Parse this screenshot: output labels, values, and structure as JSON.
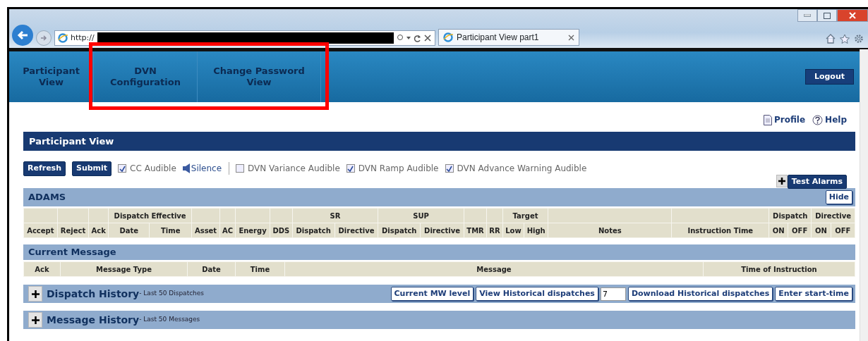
{
  "browser": {
    "address": "http://",
    "tab_title": "Participant View part1"
  },
  "nav": {
    "items": [
      {
        "label": "Participant View"
      },
      {
        "label": "DVN Configuration"
      },
      {
        "label": "Change Password View"
      }
    ],
    "logout": "Logout"
  },
  "top_links": [
    {
      "kind": "profile",
      "label": "Profile"
    },
    {
      "kind": "help",
      "label": "Help"
    }
  ],
  "panel_title": "Participant View",
  "toolbar": {
    "buttons": [
      "Refresh",
      "Submit"
    ],
    "items": [
      {
        "kind": "checkbox",
        "label": "CC Audible",
        "checked": true
      },
      {
        "kind": "speaker",
        "label": "Silence"
      },
      {
        "kind": "checkbox",
        "label": "DVN Variance Audible",
        "checked": false
      },
      {
        "kind": "checkbox",
        "label": "DVN Ramp Audible",
        "checked": true
      },
      {
        "kind": "checkbox",
        "label": "DVN Advance Warning Audible",
        "checked": true
      }
    ]
  },
  "test_alarms": "Test Alarms",
  "adams": {
    "title": "ADAMS",
    "hide": "Hide",
    "columns": [
      {
        "label": "Accept"
      },
      {
        "label": "Reject"
      },
      {
        "label": "Ack"
      },
      {
        "label": "Dispatch Effective",
        "sub": [
          "Date",
          "Time"
        ]
      },
      {
        "label": "Asset"
      },
      {
        "label": "AC"
      },
      {
        "label": "Energy"
      },
      {
        "label": "DDS"
      },
      {
        "label": "SR",
        "sub": [
          "Dispatch",
          "Directive"
        ]
      },
      {
        "label": "SUP",
        "sub": [
          "Dispatch",
          "Directive"
        ]
      },
      {
        "label": "TMR"
      },
      {
        "label": "RR"
      },
      {
        "label": "Target",
        "sub": [
          "Low",
          "High"
        ]
      },
      {
        "label": "Notes"
      },
      {
        "label": "Instruction Time"
      },
      {
        "label": "Dispatch",
        "sub": [
          "ON",
          "OFF"
        ]
      },
      {
        "label": "Directive",
        "sub": [
          "ON",
          "OFF"
        ]
      }
    ]
  },
  "current_message": {
    "title": "Current Message",
    "columns": [
      "Ack",
      "Message Type",
      "Date",
      "Time",
      "Message",
      "Time of Instruction"
    ]
  },
  "dispatch_history": {
    "title": "Dispatch History",
    "subtitle": "- Last 50 Dispatches",
    "buttons": [
      "Current MW level",
      "View Historical dispatches"
    ],
    "count": "7",
    "buttons_after": [
      "Download Historical dispatches",
      "Enter start-time"
    ]
  },
  "message_history": {
    "title": "Message History",
    "subtitle": "- Last 50 Messages"
  }
}
